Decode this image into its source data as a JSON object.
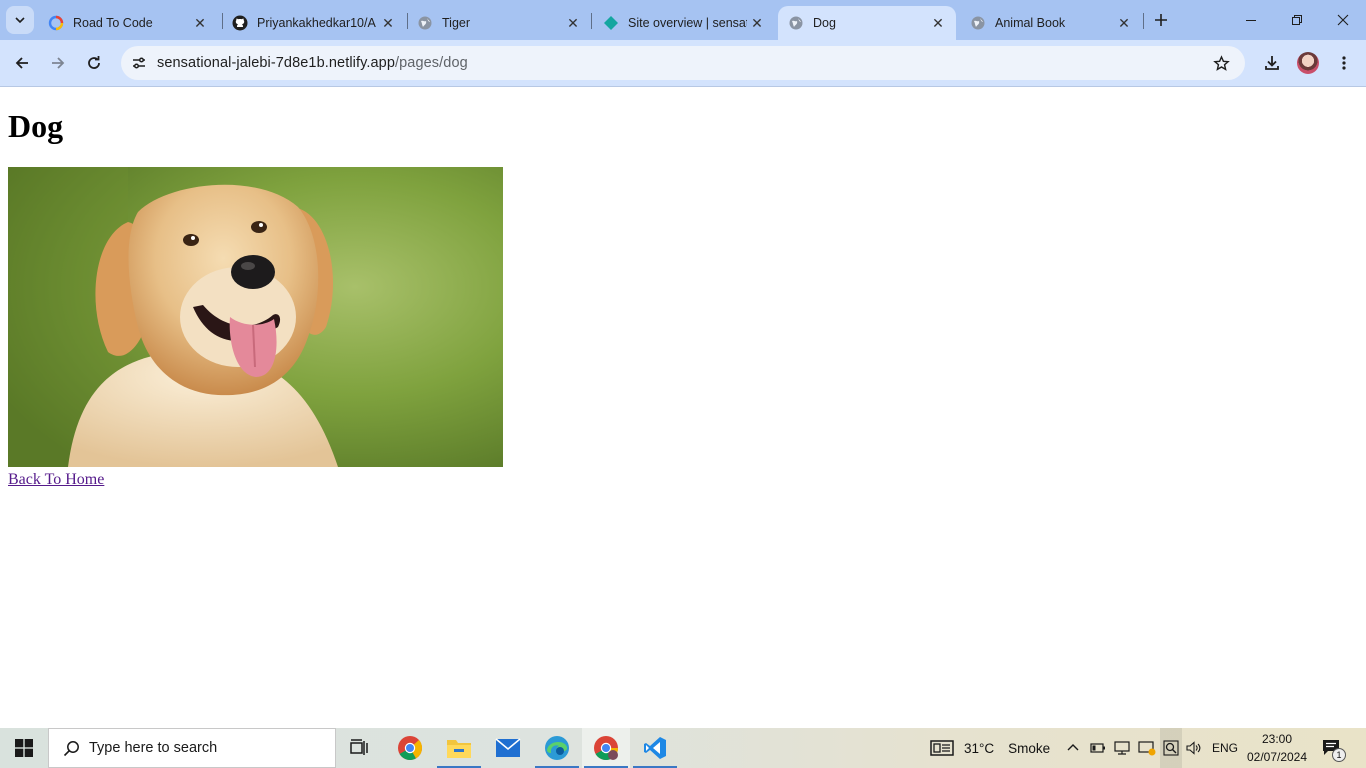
{
  "browser": {
    "tabs": [
      {
        "title": "Road To Code",
        "favicon": "gemini-icon",
        "active": false
      },
      {
        "title": "Priyankakhedkar10/A",
        "favicon": "github-icon",
        "active": false
      },
      {
        "title": "Tiger",
        "favicon": "globe-icon",
        "active": false
      },
      {
        "title": "Site overview | sensat",
        "favicon": "netlify-icon",
        "active": false
      },
      {
        "title": "Dog",
        "favicon": "globe-icon",
        "active": true
      },
      {
        "title": "Animal Book",
        "favicon": "globe-icon",
        "active": false
      }
    ],
    "address": {
      "host": "sensational-jalebi-7d8e1b.netlify.app",
      "path": "/pages/dog"
    }
  },
  "page": {
    "heading": "Dog",
    "image_alt": "dog photo",
    "back_link": "Back To Home"
  },
  "taskbar": {
    "search_placeholder": "Type here to search",
    "weather_temp": "31°C",
    "weather_desc": "Smoke",
    "language": "ENG",
    "time": "23:00",
    "date": "02/07/2024",
    "notification_count": "1"
  },
  "colors": {
    "tabstrip": "#a6c3f2",
    "toolbar": "#d3e3fd",
    "link_visited": "#551a8b",
    "accent": "#3b78c4"
  }
}
